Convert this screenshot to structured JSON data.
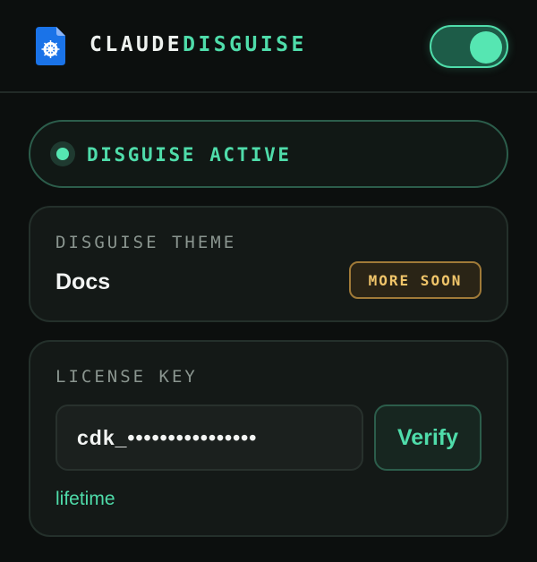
{
  "header": {
    "title_part1": "CLAUDE",
    "title_part2": "DISGUISE",
    "toggle_on": true,
    "logo_icon": "docs-file-icon"
  },
  "status": {
    "label": "DISGUISE ACTIVE"
  },
  "theme": {
    "section_label": "DISGUISE THEME",
    "value": "Docs",
    "badge": "MORE SOON"
  },
  "license": {
    "section_label": "LICENSE KEY",
    "key_value": "cdk_••••••••••••••••",
    "verify_label": "Verify",
    "status": "lifetime"
  },
  "colors": {
    "accent": "#4fdcaa",
    "badge": "#f0c56a",
    "background": "#0c0f0e"
  }
}
